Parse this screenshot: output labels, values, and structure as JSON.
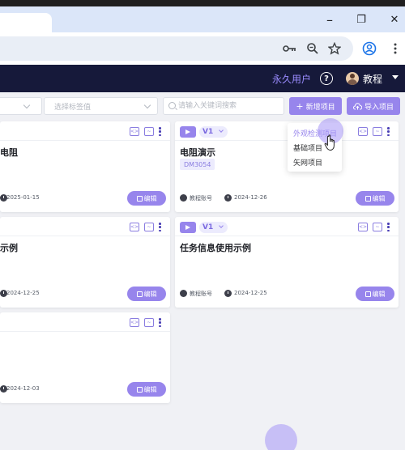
{
  "browser": {
    "window_controls": {
      "minimize": "–",
      "restore": "❐",
      "close": "✕"
    },
    "toolbar_icons": [
      "key-icon",
      "zoom-icon",
      "bookmark-star-icon",
      "profile-icon",
      "menu-kebab-icon"
    ]
  },
  "header": {
    "user_status": "永久用户",
    "help_symbol": "?",
    "course_menu": "教程"
  },
  "filters": {
    "tag_select_placeholder": "选择标签值",
    "search_placeholder": "请输入关键词搜索",
    "new_project_label": "新增项目",
    "import_project_label": "导入项目"
  },
  "new_project_menu": {
    "items": [
      "外观检测项目",
      "基础项目",
      "矢网项目"
    ]
  },
  "cards": [
    {
      "title": "电阻",
      "author": "",
      "date": "2025-01-15",
      "edit_label": "编辑"
    },
    {
      "title": "电阻演示",
      "version": "V1",
      "code": "DM3054",
      "author": "教程账号",
      "date": "2024-12-26",
      "edit_label": "编辑"
    },
    {
      "title": "示例",
      "author": "",
      "date": "2024-12-25",
      "edit_label": "编辑"
    },
    {
      "title": "任务信息使用示例",
      "version": "V1",
      "author": "教程账号",
      "date": "2024-12-25",
      "edit_label": "编辑"
    },
    {
      "title": "",
      "author": "",
      "date": "2024-12-03",
      "edit_label": "编辑"
    }
  ],
  "colors": {
    "accent": "#9785ec",
    "header_bg": "#16193a",
    "page_bg": "#f0f1f5",
    "user_status": "#9b8cff"
  }
}
